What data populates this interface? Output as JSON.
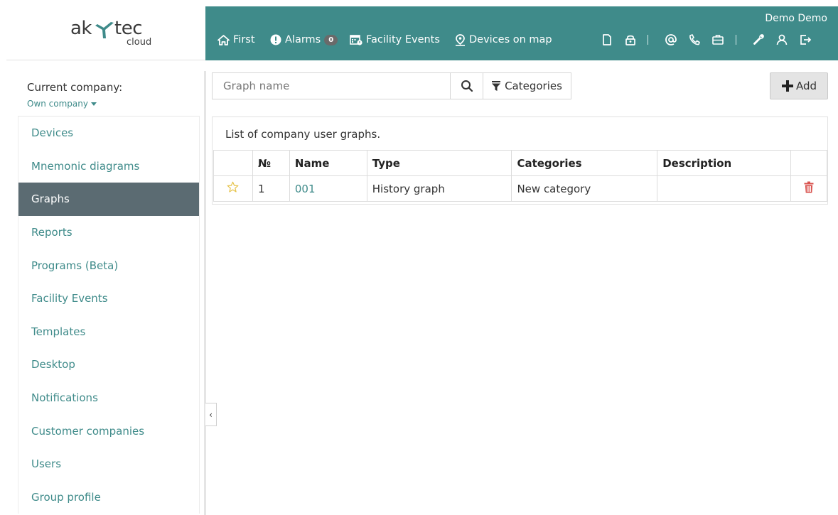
{
  "logo": {
    "left": "ak",
    "right": "tec",
    "sub": "cloud"
  },
  "header": {
    "user_name": "Demo Demo",
    "nav": {
      "first": "First",
      "alarms": "Alarms",
      "alarms_count": "0",
      "facility_events": "Facility Events",
      "devices_on_map": "Devices on map"
    },
    "icons": [
      "document-icon",
      "lock-icon",
      "at-icon",
      "phone-icon",
      "briefcase-icon",
      "wrench-icon",
      "user-icon",
      "logout-icon"
    ]
  },
  "sidebar": {
    "company_label": "Current company:",
    "company_value": "Own company",
    "items": [
      {
        "label": "Devices",
        "active": false
      },
      {
        "label": "Mnemonic diagrams",
        "active": false
      },
      {
        "label": "Graphs",
        "active": true
      },
      {
        "label": "Reports",
        "active": false
      },
      {
        "label": "Programs (Beta)",
        "active": false
      },
      {
        "label": "Facility Events",
        "active": false
      },
      {
        "label": "Templates",
        "active": false
      },
      {
        "label": "Desktop",
        "active": false
      },
      {
        "label": "Notifications",
        "active": false
      },
      {
        "label": "Customer companies",
        "active": false
      },
      {
        "label": "Users",
        "active": false
      },
      {
        "label": "Group profile",
        "active": false
      }
    ],
    "collapse_glyph": "‹"
  },
  "toolbar": {
    "search_placeholder": "Graph name",
    "categories_label": "Categories",
    "add_label": "Add"
  },
  "panel": {
    "caption": "List of company user graphs.",
    "columns": {
      "num": "№",
      "name": "Name",
      "type": "Type",
      "categories": "Categories",
      "description": "Description"
    },
    "rows": [
      {
        "num": "1",
        "name": "001",
        "type": "History graph",
        "categories": "New category",
        "description": ""
      }
    ]
  },
  "colors": {
    "accent": "#3f8b8a",
    "active_menu": "#5b6b72",
    "delete": "#d9534f",
    "star": "#e6c34a",
    "logo_mark": "#3f8b8a"
  }
}
